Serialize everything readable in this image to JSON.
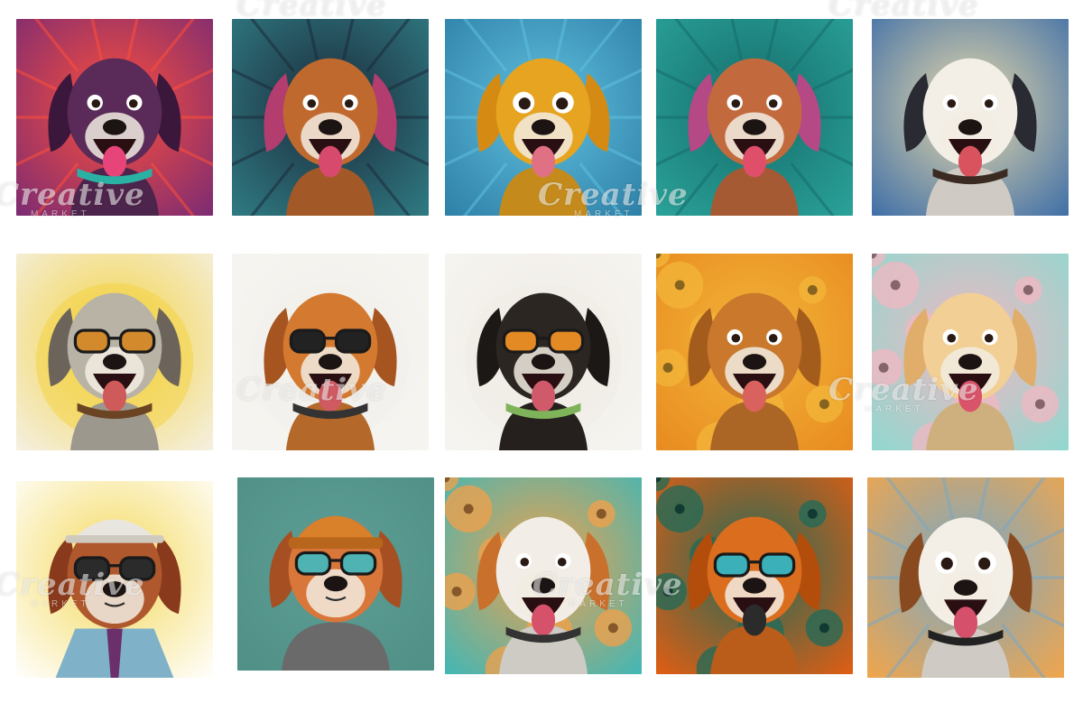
{
  "watermark": {
    "brand": "Creative",
    "sub": "MARKET"
  },
  "tiles": [
    {
      "bg": "#7a2b74",
      "bg2": "#ff4f3a",
      "fur": "#5a2a58",
      "ear": "#3b173c",
      "mouth": "#e7457a",
      "glasses": false,
      "collar": "#2bb1a4",
      "style": "wild"
    },
    {
      "bg": "#2f7c84",
      "bg2": "#1c2a3a",
      "fur": "#c0692e",
      "ear": "#b23d6e",
      "mouth": "#d84a6d",
      "glasses": false,
      "collar": "",
      "style": "wild"
    },
    {
      "bg": "#2e7fa6",
      "bg2": "#5fc0df",
      "fur": "#e6a421",
      "ear": "#d58b13",
      "mouth": "#e07184",
      "glasses": false,
      "collar": "",
      "style": "surprised"
    },
    {
      "bg": "#2aa39a",
      "bg2": "#166c6a",
      "fur": "#c26a3d",
      "ear": "#b54985",
      "mouth": "#e04f6a",
      "glasses": false,
      "collar": "",
      "style": "wild"
    },
    {
      "bg": "#3d6ea8",
      "bg2": "#e9d9a9",
      "fur": "#f3efe6",
      "ear": "#2a2a32",
      "mouth": "#d9535e",
      "glasses": false,
      "collar": "#3a2a22",
      "style": "happy"
    },
    {
      "bg": "#f4f0e4",
      "bg2": "#f3d23f",
      "fur": "#b9b3a6",
      "ear": "#6c645a",
      "mouth": "#cf5a5a",
      "glasses": true,
      "glassColor": "#d38a2c",
      "collar": "#6b4424",
      "style": "cool"
    },
    {
      "bg": "#f7f5f1",
      "bg2": "#f2f0eb",
      "fur": "#d47a30",
      "ear": "#a65420",
      "mouth": "#cf5a62",
      "glasses": true,
      "glassColor": "#222222",
      "collar": "#333333",
      "style": "cool"
    },
    {
      "bg": "#f7f5f1",
      "bg2": "#efece6",
      "fur": "#2c2622",
      "ear": "#1c1816",
      "mouth": "#d05a6a",
      "glasses": true,
      "glassColor": "#e48a24",
      "collar": "#7fb35a",
      "style": "cool"
    },
    {
      "bg": "#e88a1f",
      "bg2": "#f3b63a",
      "fur": "#c9782c",
      "ear": "#a45c1c",
      "mouth": "#d9625e",
      "glasses": false,
      "collar": "",
      "style": "pattern"
    },
    {
      "bg": "#8fd8cf",
      "bg2": "#f1b7c2",
      "fur": "#f2cf94",
      "ear": "#e1ad6a",
      "mouth": "#d9536a",
      "glasses": false,
      "collar": "",
      "style": "pattern"
    },
    {
      "bg": "#ffffff",
      "bg2": "#f4d95a",
      "fur": "#b0582d",
      "ear": "#8a3a1c",
      "mouth": "#b2455d",
      "glasses": true,
      "glassColor": "#2b2b2b",
      "collar": "#6b2f6b",
      "style": "suit"
    },
    {
      "bg": "#4f8f86",
      "bg2": "#5d9e95",
      "fur": "#d9763a",
      "ear": "#a54f22",
      "mouth": "#2b2b2b",
      "glasses": true,
      "glassColor": "#4fb3b3",
      "collar": "#4b4b4b",
      "style": "hat"
    },
    {
      "bg": "#3fb7b7",
      "bg2": "#f3a04a",
      "fur": "#f2eee7",
      "ear": "#c9702c",
      "mouth": "#d5526a",
      "glasses": false,
      "collar": "#333333",
      "style": "pattern"
    },
    {
      "bg": "#e35d12",
      "bg2": "#1e6b5a",
      "fur": "#db6d1e",
      "ear": "#b34d0c",
      "mouth": "#2b2b2b",
      "glasses": true,
      "glassColor": "#3bb0b8",
      "collar": "",
      "style": "pattern"
    },
    {
      "bg": "#f2a54a",
      "bg2": "#77a8c8",
      "fur": "#f4efe6",
      "ear": "#8a4a20",
      "mouth": "#d5506a",
      "glasses": false,
      "collar": "#222222",
      "style": "surprised"
    }
  ]
}
